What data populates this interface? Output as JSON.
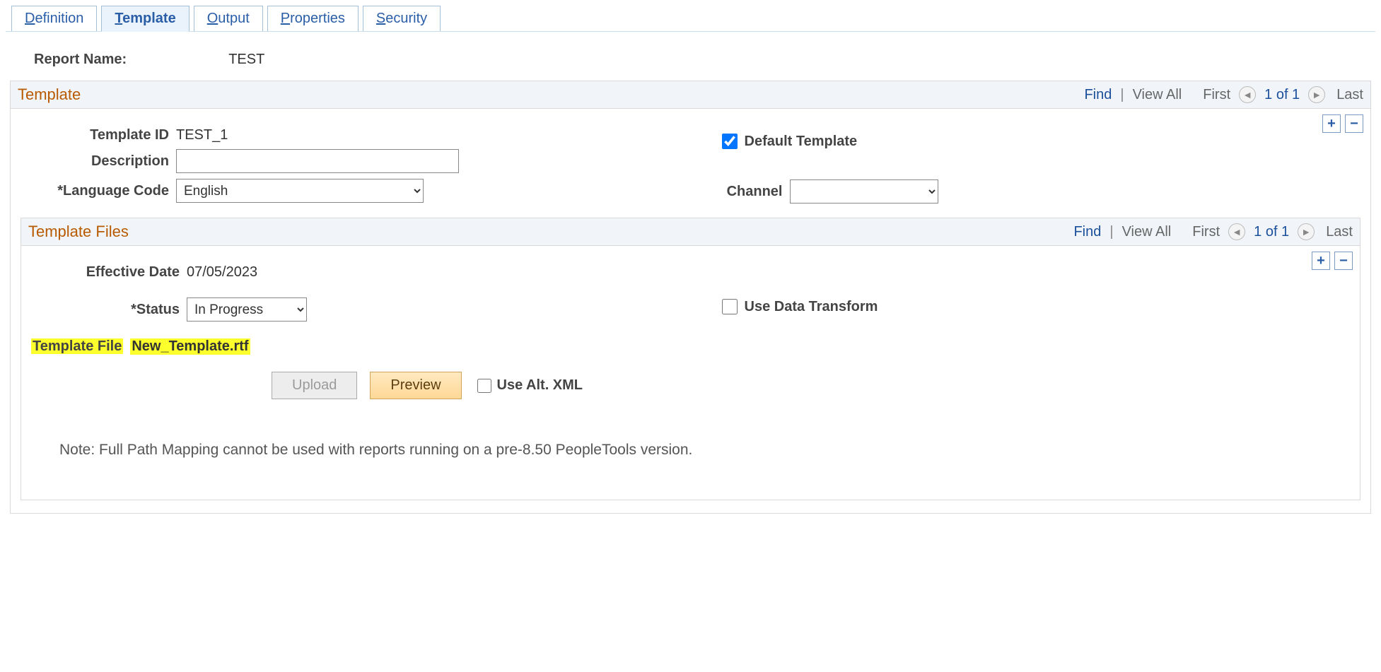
{
  "tabs": {
    "definition": "Definition",
    "template": "Template",
    "output": "Output",
    "properties": "Properties",
    "security": "Security"
  },
  "report": {
    "label": "Report Name:",
    "value": "TEST"
  },
  "templateSection": {
    "title": "Template",
    "find": "Find",
    "viewAll": "View All",
    "first": "First",
    "count": "1 of 1",
    "last": "Last",
    "templateIdLabel": "Template ID",
    "templateIdValue": "TEST_1",
    "descriptionLabel": "Description",
    "descriptionValue": "",
    "languageLabel": "*Language Code",
    "languageValue": "English",
    "channelLabel": "Channel",
    "channelValue": "",
    "defaultTemplateLabel": "Default Template",
    "defaultTemplateChecked": true
  },
  "filesSection": {
    "title": "Template Files",
    "find": "Find",
    "viewAll": "View All",
    "first": "First",
    "count": "1 of 1",
    "last": "Last",
    "effDateLabel": "Effective Date",
    "effDateValue": "07/05/2023",
    "statusLabel": "*Status",
    "statusValue": "In Progress",
    "useDataTransformLabel": "Use Data Transform",
    "useDataTransformChecked": false,
    "templateFileLabel": "Template File",
    "templateFileValue": "New_Template.rtf",
    "uploadLabel": "Upload",
    "previewLabel": "Preview",
    "useAltXmlLabel": "Use Alt. XML",
    "useAltXmlChecked": false,
    "note": "Note: Full Path Mapping cannot be used with reports running on a pre-8.50 PeopleTools version."
  }
}
